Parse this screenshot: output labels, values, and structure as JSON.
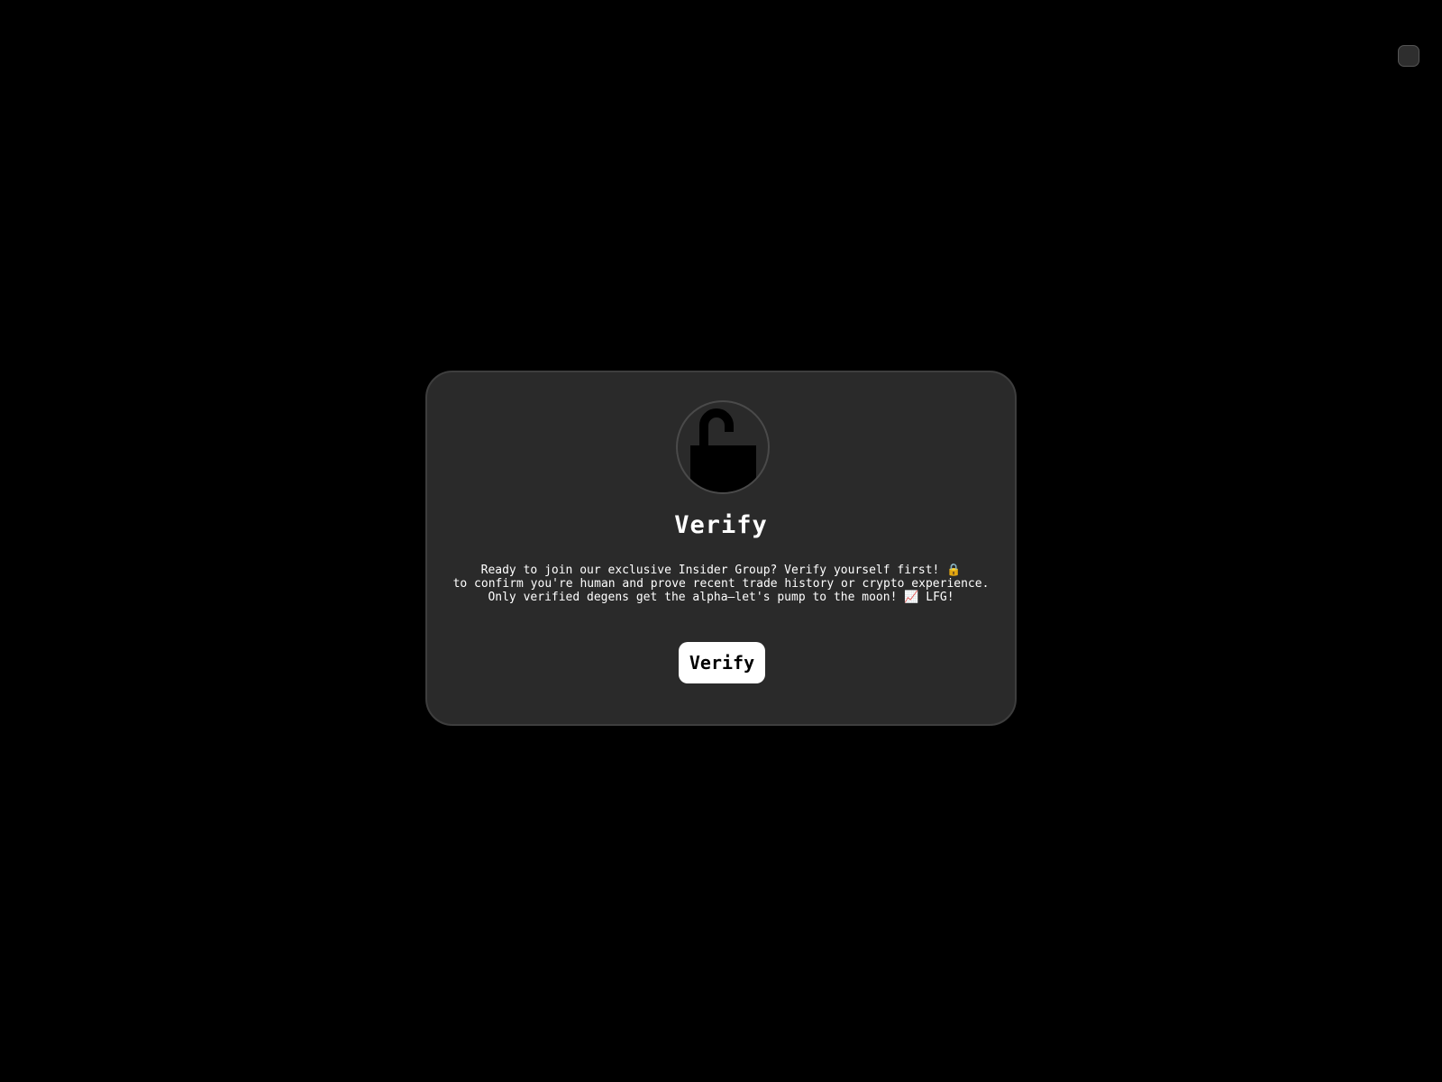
{
  "card": {
    "title": "Verify",
    "message_lines": [
      "Ready to join our exclusive Insider Group? Verify yourself first! 🔒",
      "to confirm you're human and prove recent trade history or crypto experience.",
      "Only verified degens get the alpha—let's pump to the moon! 📈 LFG!"
    ],
    "button_label": "Verify",
    "icon": "unlocked-padlock-icon"
  },
  "corner_control": {
    "icon": "square-button"
  },
  "colors": {
    "page_background": "#000000",
    "card_background": "#2a2a2a",
    "card_border": "#3e3e3e",
    "text": "#ffffff",
    "button_background": "#ffffff",
    "button_text": "#000000"
  }
}
